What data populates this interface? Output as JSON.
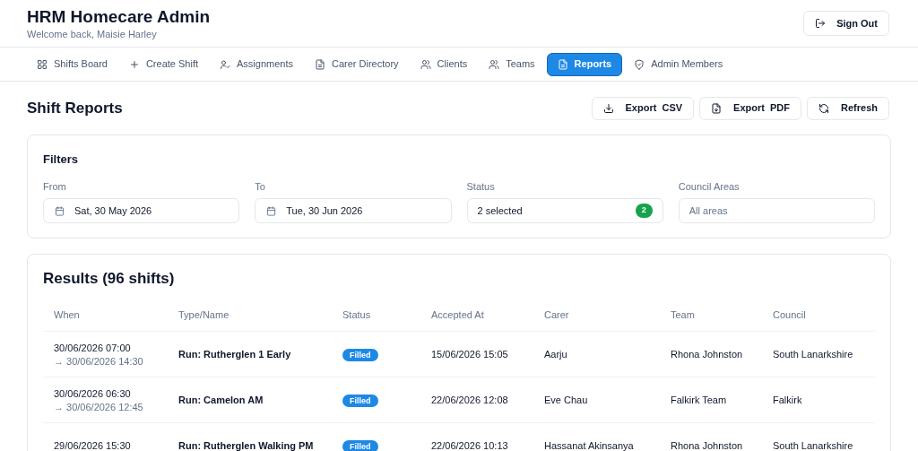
{
  "header": {
    "title": "HRM Homecare Admin",
    "subtitle": "Welcome back, Maisie Harley",
    "sign_out": "Sign Out"
  },
  "tabs": [
    {
      "label": "Shifts Board",
      "selected": false
    },
    {
      "label": "Create Shift",
      "selected": false
    },
    {
      "label": "Assignments",
      "selected": false
    },
    {
      "label": "Carer Directory",
      "selected": false
    },
    {
      "label": "Clients",
      "selected": false
    },
    {
      "label": "Teams",
      "selected": false
    },
    {
      "label": "Reports",
      "selected": true
    },
    {
      "label": "Admin Members",
      "selected": false
    }
  ],
  "page_title": "Shift Reports",
  "actions": [
    "Export  CSV",
    "Export  PDF",
    "Refresh"
  ],
  "filters": {
    "title": "Filters",
    "fields": [
      {
        "kind": "date",
        "label": "From",
        "value": "Sat, 30 May 2026"
      },
      {
        "kind": "date",
        "label": "To",
        "value": "Tue, 30 Jun 2026"
      },
      {
        "kind": "select",
        "label": "Status",
        "value": "2 selected",
        "count": "2"
      },
      {
        "kind": "text",
        "label": "Council Areas",
        "placeholder": "All areas"
      }
    ]
  },
  "results": {
    "title": "Results (96 shifts)",
    "columns": [
      "When",
      "Type/Name",
      "Status",
      "Accepted At",
      "Carer",
      "Team",
      "Council"
    ],
    "rows": [
      {
        "start": "30/06/2026 07:00",
        "end": "→ 30/06/2026 14:30",
        "name": "Run: Rutherglen 1 Early",
        "status": "Filled",
        "accepted": "15/06/2026 15:05",
        "carer": "Aarju",
        "team": "Rhona Johnston",
        "council": "South Lanarkshire"
      },
      {
        "start": "30/06/2026 06:30",
        "end": "→ 30/06/2026 12:45",
        "name": "Run: Camelon AM",
        "status": "Filled",
        "accepted": "22/06/2026 12:08",
        "carer": "Eve Chau",
        "team": "Falkirk Team",
        "council": "Falkirk"
      },
      {
        "start": "29/06/2026 15:30",
        "name": "Run: Rutherglen Walking PM",
        "status": "Filled",
        "accepted": "22/06/2026 10:13",
        "carer": "Hassanat Akinsanya",
        "team": "Rhona Johnston",
        "council": "South Lanarkshire"
      }
    ]
  }
}
